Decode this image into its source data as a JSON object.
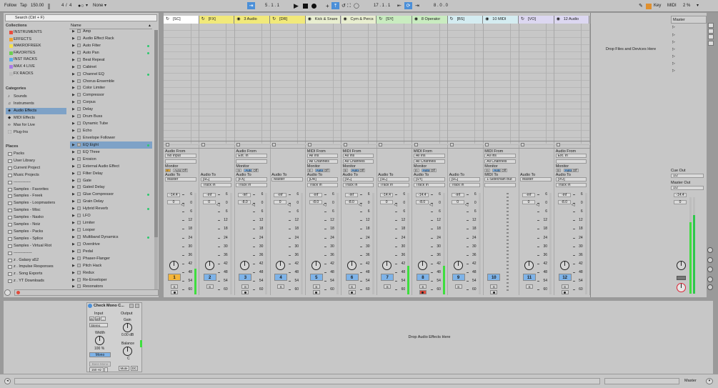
{
  "topbar": {
    "follow": "Follow",
    "tap": "Tap",
    "tempo": "150.00",
    "sig_num": "4",
    "sig_den": "4",
    "metro": "1 Bar",
    "none": "None",
    "pos": "5 . 1 . 1",
    "pos2": "17 . 1 . 1",
    "len": "8 . 0 . 0",
    "key": "Key",
    "midi": "MIDI",
    "cpu": "2 %"
  },
  "browser": {
    "search_placeholder": "Search (Ctrl + F)",
    "collections_head": "Collections",
    "collections": [
      {
        "label": "INSTRUMENTS",
        "color": "#e94c3c"
      },
      {
        "label": "EFFECTS",
        "color": "#f2a42d"
      },
      {
        "label": "MAKROFREEK",
        "color": "#f4e04d"
      },
      {
        "label": "FAVORITES",
        "color": "#6ccf52"
      },
      {
        "label": "INST RACKS",
        "color": "#5aaef0"
      },
      {
        "label": "MAX 4 LIVE",
        "color": "#a87ae8"
      },
      {
        "label": "FX RACKS",
        "color": "#bbbbbb"
      }
    ],
    "categories_head": "Categories",
    "categories": [
      "Sounds",
      "Instruments",
      "Audio Effects",
      "MIDI Effects",
      "Max for Live",
      "Plug-Ins"
    ],
    "places_head": "Places",
    "places": [
      "Packs",
      "User Library",
      "Current Project",
      "Music Projects",
      "-------------",
      "Samples - Favorites",
      "Samples - Freek",
      "Samples - Loopmasters",
      "Samples - Misc",
      "Samples - Nasko",
      "Samples - Noiz",
      "Samples - Packs",
      "Samples - Splice",
      "Samples - Virtual Riot",
      "--------------",
      "z . Galaxy a52",
      "z . Impulse Responses",
      "z . Song Exports",
      "z . YT Downloads"
    ],
    "name_head": "Name",
    "items": [
      "Amp",
      "Audio Effect Rack",
      "Auto Filter",
      "Auto Pan",
      "Beat Repeat",
      "Cabinet",
      "Channel EQ",
      "Chorus-Ensemble",
      "Color Limiter",
      "Compressor",
      "Corpus",
      "Delay",
      "Drum Buss",
      "Dynamic Tube",
      "Echo",
      "Envelope Follower",
      "EQ Eight",
      "EQ Three",
      "Erosion",
      "External Audio Effect",
      "Filter Delay",
      "Gate",
      "Gated Delay",
      "Glue Compressor",
      "Grain Delay",
      "Hybrid Reverb",
      "LFO",
      "Limiter",
      "Looper",
      "Multiband Dynamics",
      "Overdrive",
      "Pedal",
      "Phaser-Flanger",
      "Pitch Hack",
      "Redux",
      "Re-Enveloper",
      "Resonators"
    ]
  },
  "tracks": [
    {
      "name": "[SC]",
      "color": "#ffffff",
      "type": "Audio From",
      "from": "No Input",
      "from2": "",
      "mon": [
        "In",
        "Auto",
        "Off"
      ],
      "monOn": 0,
      "to": "Master",
      "vol": "-14.4",
      "pan": "0",
      "ticks": "6",
      "num": "1",
      "numColor": "#f4b53a"
    },
    {
      "name": "[FX]",
      "color": "#f1e97a",
      "type": "Audio To",
      "from": "",
      "from2": "",
      "mon": [],
      "to": "[SC]",
      "to2": "Track In",
      "vol": "-inf",
      "pan": "0",
      "num": "2",
      "numColor": "#7eb3e8"
    },
    {
      "name": "3 Audio",
      "color": "#f1e97a",
      "type": "Audio From",
      "from": "Ext. In",
      "from2": "",
      "mon": [
        "In",
        "Auto",
        "Off"
      ],
      "to": "[FX]",
      "to2": "Track In",
      "vol": "-inf",
      "pan": "-8.0",
      "num": "3",
      "numColor": "#7eb3e8"
    },
    {
      "name": "[DR]",
      "color": "#f1e97a",
      "type": "Audio To",
      "to": "Master",
      "vol": "-inf",
      "pan": "0",
      "num": "4",
      "numColor": "#7eb3e8"
    },
    {
      "name": "Kick & Snare",
      "color": "#e8eed0",
      "type": "MIDI From",
      "from": "All Ins",
      "from2": "All Channels",
      "mon": [
        "In",
        "Auto",
        "Off"
      ],
      "to": "[DR]",
      "to2": "Track In",
      "vol": "-inf",
      "pan": "-8.0",
      "num": "5",
      "numColor": "#7eb3e8"
    },
    {
      "name": "Cym & Percs",
      "color": "#e8eed0",
      "type": "MIDI From",
      "from": "All Ins",
      "from2": "All Channels",
      "mon": [
        "In",
        "Auto",
        "Off"
      ],
      "to": "[SC]",
      "to2": "Track In",
      "vol": "-inf",
      "pan": "-8.0",
      "num": "6",
      "numColor": "#7eb3e8"
    },
    {
      "name": "[SY]",
      "color": "#c9ecc0",
      "type": "Audio To",
      "to": "[SC]",
      "to2": "Track In",
      "vol": "-14.4",
      "pan": "0",
      "num": "7",
      "numColor": "#7eb3e8"
    },
    {
      "name": "8 Operator",
      "color": "#c9ecc0",
      "type": "MIDI From",
      "from": "All Ins",
      "from2": "All Channels",
      "mon": [
        "In",
        "Auto",
        "Off"
      ],
      "to": "[SY]",
      "to2": "Track In",
      "vol": "-14.4",
      "pan": "-8.0",
      "num": "8",
      "numColor": "#7eb3e8"
    },
    {
      "name": "[BS]",
      "color": "#d4ecf1",
      "type": "Audio To",
      "to": "[SC]",
      "to2": "Track In",
      "vol": "-inf",
      "pan": "0",
      "num": "9",
      "numColor": "#7eb3e8"
    },
    {
      "name": "10 MIDI",
      "color": "#d4ecf1",
      "type": "MIDI From",
      "from": "All Ins",
      "from2": "All Channels",
      "mon": [
        "In",
        "Auto",
        "Off"
      ],
      "to": "1-Sidechain But",
      "to2": "",
      "vol": "",
      "pan": "",
      "num": "10",
      "numColor": "#7eb3e8"
    },
    {
      "name": "[VO]",
      "color": "#dcd7f1",
      "type": "Audio To",
      "to": "Master",
      "vol": "-inf",
      "pan": "0",
      "num": "11",
      "numColor": "#7eb3e8"
    },
    {
      "name": "12 Audio",
      "color": "#dcd7f1",
      "type": "Audio From",
      "from": "Ext. In",
      "from2": "",
      "mon": [
        "In",
        "Auto",
        "Off"
      ],
      "to": "[VO]",
      "to2": "Track In",
      "vol": "-inf",
      "pan": "-8.0",
      "num": "12",
      "numColor": "#7eb3e8"
    }
  ],
  "labels": {
    "monitor": "Monitor",
    "audio_to": "Audio To",
    "midi_to": "MIDI To",
    "drop_files": "Drop Files and Devices Here",
    "drop_effects": "Drop Audio Effects Here",
    "s": "S",
    "dbticks": [
      "6",
      "0",
      "6",
      "12",
      "18",
      "24",
      "30",
      "36",
      "42",
      "48",
      "54",
      "60"
    ]
  },
  "master": {
    "name": "Master",
    "cue_out": "Cue Out",
    "cue_val": "1/2",
    "master_out": "Master Out",
    "master_val": "1/2",
    "vol": "-14.4",
    "pan": "0"
  },
  "device": {
    "title": "Check Mono C...",
    "input": "Input",
    "output": "Output",
    "width": "Width",
    "width_val": "100 %",
    "mono": "Mono",
    "gain": "Gain",
    "gain_val": "0.00 dB",
    "balance": "Balance",
    "balance_val": "C",
    "mute": "Mute",
    "dc": "DC",
    "bass_mono": "Bass Mono",
    "freq": "150 Hz",
    "stereo": "Stereo"
  },
  "bottombar": {
    "master": "Master"
  }
}
